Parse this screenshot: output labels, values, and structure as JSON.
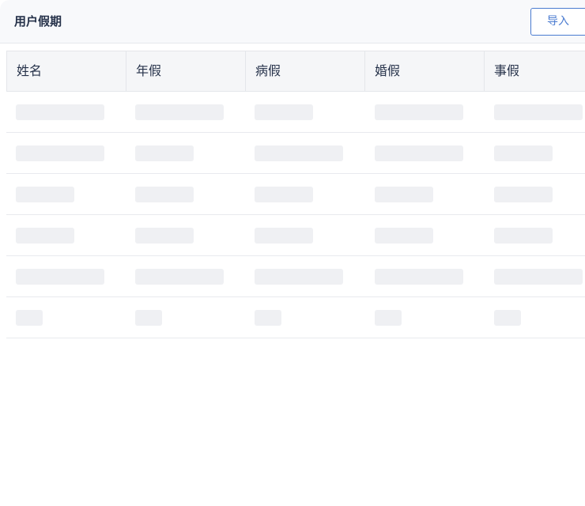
{
  "header": {
    "title": "用户假期",
    "import_label": "导入"
  },
  "table": {
    "columns": [
      "姓名",
      "年假",
      "病假",
      "婚假",
      "事假"
    ],
    "loading": true,
    "skeleton_rows": 6
  },
  "colors": {
    "accent": "#4a7bd0",
    "text": "#26324a",
    "header_bg": "#f8f9fb",
    "table_header_bg": "#f5f6f8",
    "skeleton": "#eff0f3"
  }
}
